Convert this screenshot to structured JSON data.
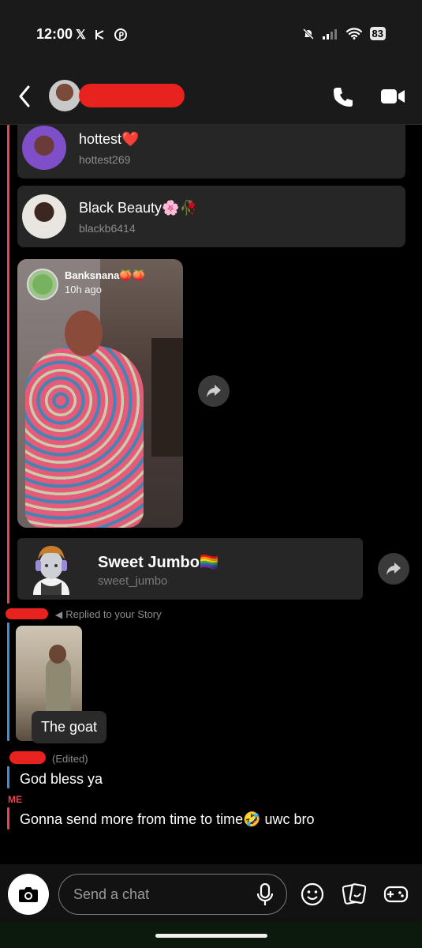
{
  "status_bar": {
    "time": "12:00",
    "icons_left": [
      "x-logo-icon",
      "bluesky-icon",
      "pinterest-icon"
    ],
    "battery": "83"
  },
  "header": {
    "back_icon": "chevron-left-icon",
    "call_icon": "phone-icon",
    "video_icon": "video-camera-icon"
  },
  "messages": {
    "contacts": [
      {
        "name": "hottest❤️",
        "username": "hottest269"
      },
      {
        "name": "Black Beauty🌸🥀",
        "username": "blackb6414"
      }
    ],
    "story": {
      "name": "Banksnana🍑🍑",
      "time": "10h ago"
    },
    "shared_contact": {
      "name": "Sweet Jumbo🏳️‍🌈",
      "username": "sweet_jumbo"
    },
    "reply_note": "Replied to your Story",
    "reply_caption": "The goat",
    "edited_label": "(Edited)",
    "reply_message": "God bless ya",
    "me_label": "ME",
    "my_message": "Gonna send more from time to time🤣 uwc bro"
  },
  "input": {
    "placeholder": "Send a chat"
  },
  "colors": {
    "accent_red": "#e8454f",
    "accent_blue": "#3c8fd8",
    "redaction": "#e8221f"
  }
}
